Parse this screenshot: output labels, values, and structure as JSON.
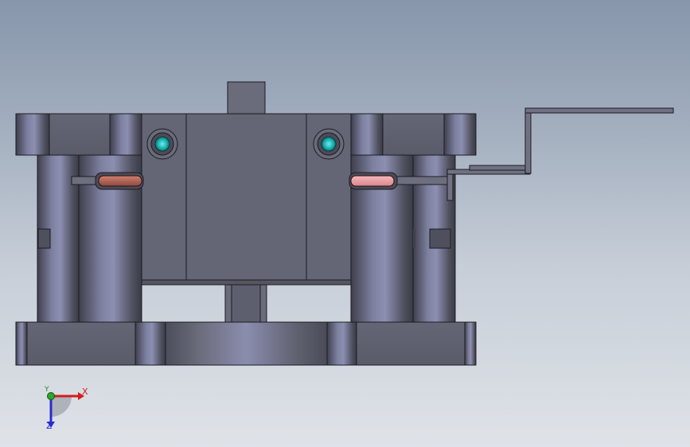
{
  "viewport": {
    "background_top": "#8796ab",
    "background_bottom": "#dfe3e8"
  },
  "model": {
    "body_color": "#5f6070",
    "edge_color": "#1c1c22",
    "bolt_color": "#1fb6b6",
    "left_pad_color": "#b5695c",
    "right_pad_color": "#e69aa0"
  },
  "triad": {
    "x_label": "X",
    "y_label": "Y",
    "z_label": "Z",
    "x_color": "#d21e1e",
    "y_color": "#2a8a2a",
    "z_color": "#2b2bd0"
  }
}
